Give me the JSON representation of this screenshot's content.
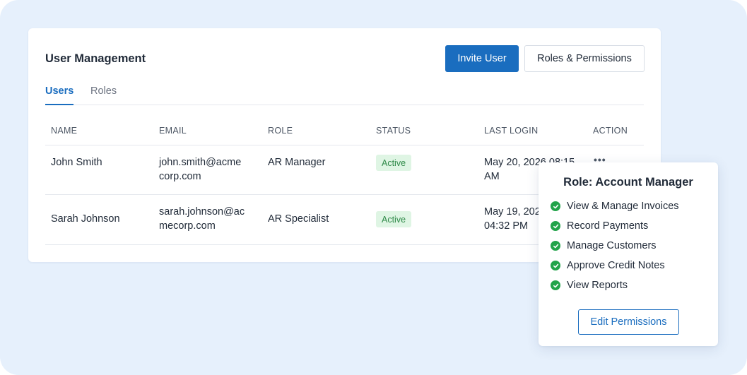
{
  "header": {
    "title": "User Management",
    "invite_label": "Invite User",
    "roles_permissions_label": "Roles & Permissions"
  },
  "tabs": [
    {
      "label": "Users",
      "active": true
    },
    {
      "label": "Roles",
      "active": false
    }
  ],
  "table": {
    "columns": [
      "NAME",
      "EMAIL",
      "ROLE",
      "STATUS",
      "LAST LOGIN",
      "ACTION"
    ],
    "rows": [
      {
        "name": "John Smith",
        "email_line1": "john.smith@acme",
        "email_line2": "corp.com",
        "role": "AR Manager",
        "status": "Active",
        "last_login_line1": "May 20, 2026 08:15",
        "last_login_line2": "AM",
        "action_icon": "more-horizontal-icon"
      },
      {
        "name": "Sarah Johnson",
        "email_line1": "sarah.johnson@ac",
        "email_line2": "mecorp.com",
        "role": "AR Specialist",
        "status": "Active",
        "last_login_line1": "May 19, 2026",
        "last_login_line2": "04:32 PM",
        "action_icon": "more-horizontal-icon"
      }
    ]
  },
  "popover": {
    "title": "Role: Account Manager",
    "permissions": [
      "View & Manage Invoices",
      "Record Payments",
      "Manage Customers",
      "Approve Credit Notes",
      "View Reports"
    ],
    "edit_label": "Edit Permissions",
    "check_icon": "check-circle-icon"
  },
  "colors": {
    "background": "#e6f0fc",
    "accent": "#1a6dbf",
    "status_active_bg": "#dff5e4",
    "status_active_text": "#2f8a49",
    "check": "#22a34a"
  }
}
